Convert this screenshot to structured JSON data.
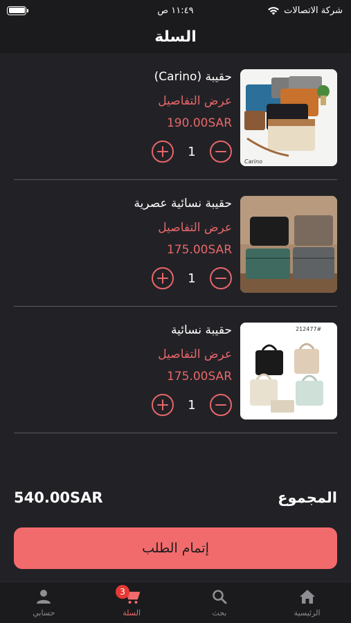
{
  "status_bar": {
    "carrier": "شركة الاتصالات",
    "time": "١١:٤٩ ص",
    "battery_level": 1.0
  },
  "header": {
    "title": "السلة"
  },
  "cart": {
    "items": [
      {
        "name": "حقيبة (Carino)",
        "details_label": "عرض التفاصيل",
        "price": "190.00SAR",
        "quantity": "1",
        "image_caption": "Carino"
      },
      {
        "name": "حقيبة نسائية عصرية",
        "details_label": "عرض التفاصيل",
        "price": "175.00SAR",
        "quantity": "1"
      },
      {
        "name": "حقيبة نسائية",
        "details_label": "عرض التفاصيل",
        "price": "175.00SAR",
        "quantity": "1",
        "image_caption": "212477#"
      }
    ]
  },
  "summary": {
    "total_label": "المجموع",
    "total_value": "540.00SAR"
  },
  "checkout": {
    "label": "إتمام الطلب"
  },
  "tab_bar": {
    "tabs": [
      {
        "label": "حسابي",
        "icon": "person-icon"
      },
      {
        "label": "السلة",
        "icon": "cart-icon",
        "badge": "3",
        "active": true
      },
      {
        "label": "بحث",
        "icon": "search-icon"
      },
      {
        "label": "الرئيسية",
        "icon": "home-icon"
      }
    ]
  },
  "colors": {
    "accent": "#f26b6c",
    "price": "#e8676b",
    "background": "#222226",
    "bar": "#1b1b1d"
  }
}
